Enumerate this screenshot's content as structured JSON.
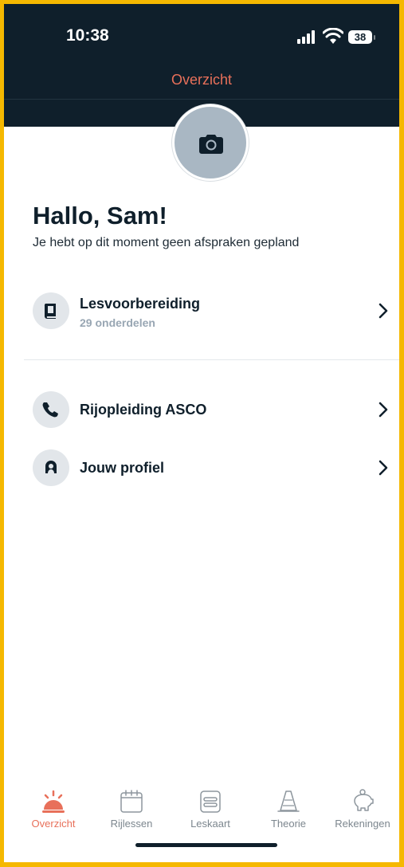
{
  "status_bar": {
    "time": "10:38",
    "battery": "38"
  },
  "header": {
    "title": "Overzicht"
  },
  "greeting": "Hallo, Sam!",
  "subtext": "Je hebt op dit moment geen afspraken gepland",
  "menu": [
    {
      "label": "Lesvoorbereiding",
      "sub": "29 onderdelen",
      "icon": "book-icon"
    },
    {
      "label": "Rijopleiding ASCO",
      "icon": "phone-icon"
    },
    {
      "label": "Jouw profiel",
      "icon": "person-icon"
    }
  ],
  "tabs": [
    {
      "label": "Overzicht",
      "icon": "sunrise-icon",
      "active": true
    },
    {
      "label": "Rijlessen",
      "icon": "calendar-icon"
    },
    {
      "label": "Leskaart",
      "icon": "card-icon"
    },
    {
      "label": "Theorie",
      "icon": "cone-icon"
    },
    {
      "label": "Rekeningen",
      "icon": "piggy-bank-icon"
    }
  ],
  "colors": {
    "accent": "#e8705a",
    "header_bg": "#0f1f2b",
    "frame": "#f5b800"
  }
}
